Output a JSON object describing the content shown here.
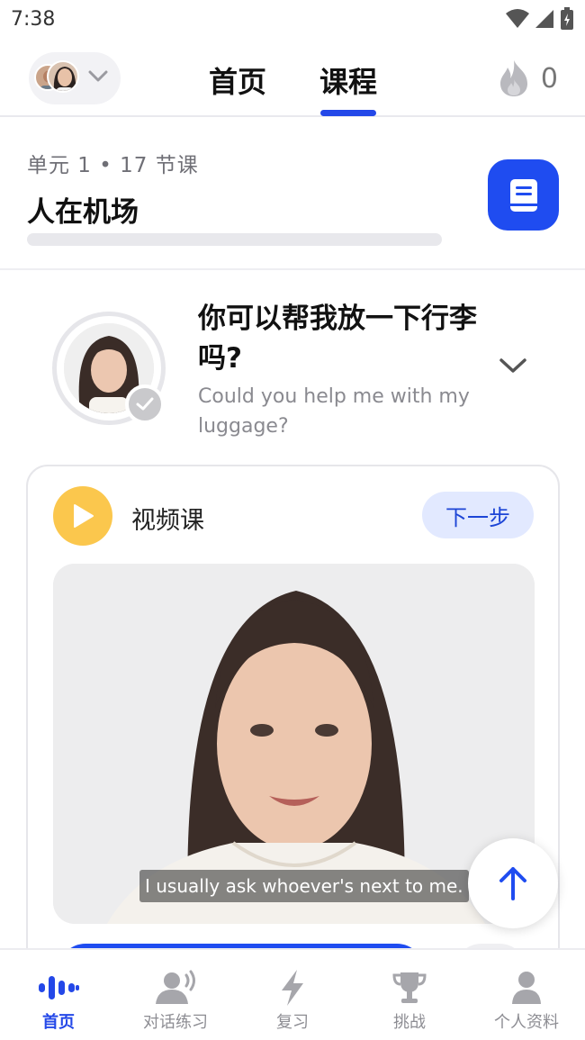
{
  "status_bar": {
    "time": "7:38"
  },
  "top_nav": {
    "tabs": [
      {
        "label": "首页"
      },
      {
        "label": "课程"
      }
    ],
    "active_tab": "课程",
    "streak_count": "0"
  },
  "unit": {
    "subtitle": "单元 1 • 17 节课",
    "title": "人在机场",
    "progress": 0
  },
  "lesson": {
    "title_cn": "你可以帮我放一下行李吗?",
    "title_en": "Could you help me with my luggage?"
  },
  "video_card": {
    "label": "视频课",
    "next_label": "下一步",
    "subtitle": "I usually ask whoever's next to me."
  },
  "bottom_nav": {
    "items": [
      {
        "label": "首页",
        "icon": "waveform-icon"
      },
      {
        "label": "对话练习",
        "icon": "speaking-person-icon"
      },
      {
        "label": "复习",
        "icon": "lightning-icon"
      },
      {
        "label": "挑战",
        "icon": "trophy-icon"
      },
      {
        "label": "个人资料",
        "icon": "person-icon"
      }
    ],
    "active": "首页"
  },
  "colors": {
    "accent": "#2448e8",
    "play_yellow": "#fbc74d",
    "next_bg": "#e2e9ff"
  }
}
